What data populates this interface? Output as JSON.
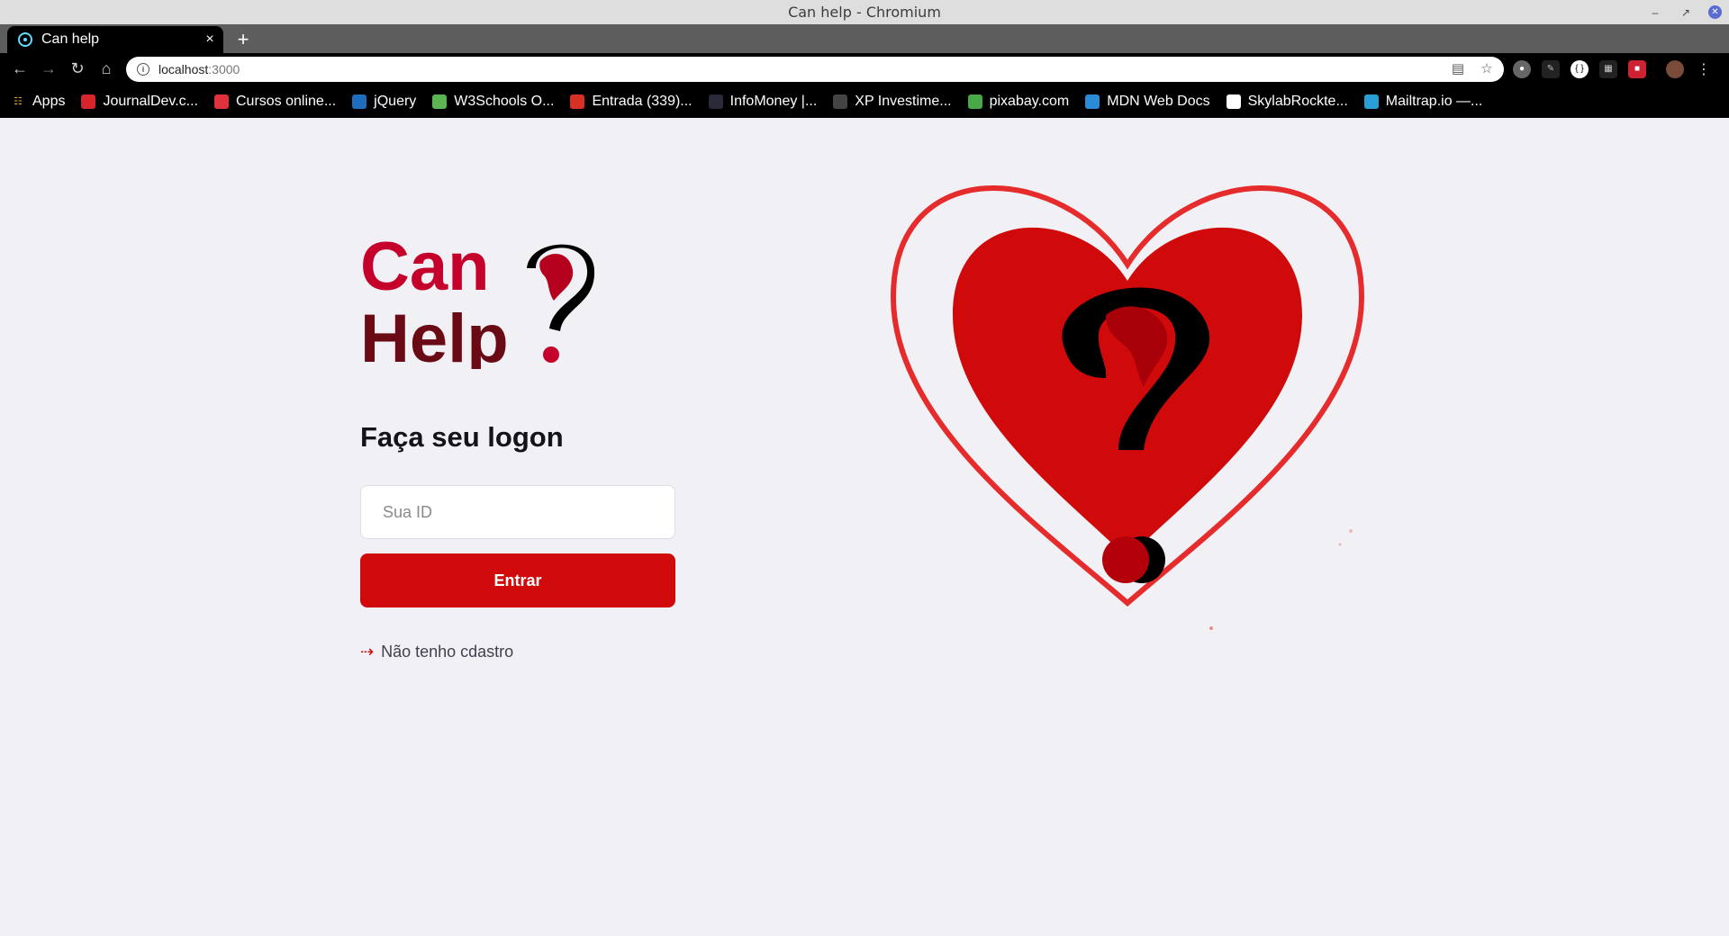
{
  "window": {
    "title": "Can help - Chromium"
  },
  "tab": {
    "title": "Can help",
    "close": "×",
    "new_tab": "+"
  },
  "toolbar": {
    "url_host": "localhost",
    "url_port": ":3000"
  },
  "bookmarks": [
    {
      "label": "Apps",
      "icon": "apps-grid-icon",
      "color": "#e8a33d"
    },
    {
      "label": "JournalDev.c...",
      "icon": "journaldev-icon",
      "color": "#d6262b"
    },
    {
      "label": "Cursos online...",
      "icon": "udemy-icon",
      "color": "#e0323a"
    },
    {
      "label": "jQuery",
      "icon": "jquery-icon",
      "color": "#1d6fbd"
    },
    {
      "label": "W3Schools O...",
      "icon": "w3schools-icon",
      "color": "#5ab552"
    },
    {
      "label": "Entrada (339)...",
      "icon": "gmail-icon",
      "color": "#d93025"
    },
    {
      "label": "InfoMoney |...",
      "icon": "infomoney-icon",
      "color": "#2a2a3a"
    },
    {
      "label": "XP Investime...",
      "icon": "xp-icon",
      "color": "#444444"
    },
    {
      "label": "pixabay.com",
      "icon": "pixabay-icon",
      "color": "#48a947"
    },
    {
      "label": "MDN Web Docs",
      "icon": "mdn-icon",
      "color": "#2b8bd7"
    },
    {
      "label": "SkylabRockte...",
      "icon": "rocketseat-icon",
      "color": "#ffffff"
    },
    {
      "label": "Mailtrap.io —...",
      "icon": "mailtrap-icon",
      "color": "#2a9fd6"
    }
  ],
  "logon": {
    "title": "Faça seu logon",
    "id_placeholder": "Sua ID",
    "id_value": "",
    "submit_label": "Entrar",
    "register_label": "Não tenho cdastro"
  },
  "logo": {
    "line1": "Can",
    "line2": "Help"
  },
  "colors": {
    "brand_red": "#d00a0a",
    "logo_crimson": "#c4002b",
    "logo_dark": "#6a0a14",
    "background": "#f0f0f5"
  }
}
